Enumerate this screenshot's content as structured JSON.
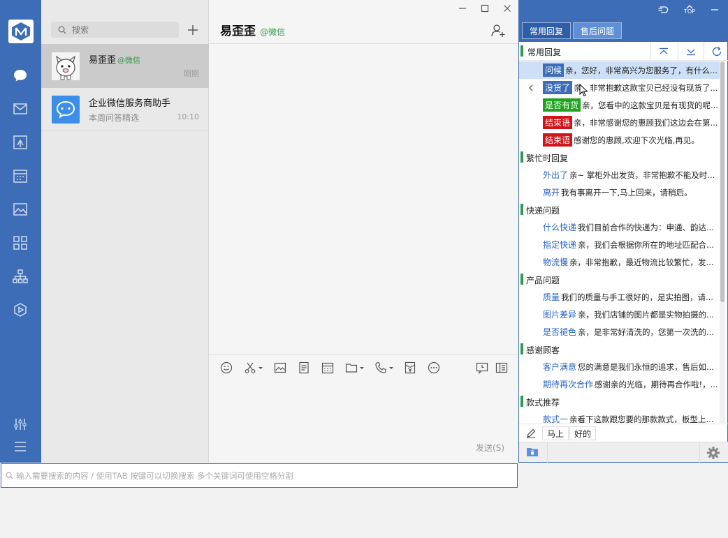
{
  "nav": {
    "items": [
      "chat-icon",
      "mail-icon",
      "share-icon",
      "calendar-icon",
      "photo-icon",
      "apps-icon",
      "org-chart-icon",
      "hexagon-play-icon"
    ],
    "bottom": [
      "settings-sliders-icon",
      "menu-icon"
    ]
  },
  "conversations": {
    "search_placeholder": "搜索",
    "items": [
      {
        "name": "易歪歪",
        "tag": "@微信",
        "subtitle": "",
        "time": "刚刚"
      },
      {
        "name": "企业微信服务商助手",
        "tag": "",
        "subtitle": "本周问答精选",
        "time": "10:10"
      }
    ]
  },
  "chat": {
    "title": "易歪歪",
    "title_suffix": "@微信",
    "send_label": "发送(S)"
  },
  "bottom_search": {
    "placeholder": "输入需要搜索的内容 / 使用TAB 按键可以切换搜索 多个关键词可使用空格分割"
  },
  "quick_reply": {
    "top_icons": [
      "undo-icon",
      "top-icon",
      "minimize-icon"
    ],
    "top_label": "TOP",
    "tabs": [
      "常用回复",
      "售后问题"
    ],
    "header": "常用回复",
    "categories": [
      {
        "name": "常用回复",
        "show_header": false,
        "rows": [
          {
            "key": "问候",
            "badge": "#3d6db7",
            "text": "亲，您好，非常高兴为您服务了，有什么...",
            "selected": true
          },
          {
            "key": "没货了",
            "badge": "#3d6db7",
            "text": "亲，非常抱歉这款宝贝已经没有现货了...",
            "selected": false
          },
          {
            "key": "是否有货",
            "badge": "#1ea31e",
            "text": "亲，您看中的这款宝贝是有现货的呢...",
            "selected": false
          },
          {
            "key": "结束语",
            "badge": "#d0141a",
            "text": "亲，非常感谢您的惠顾我们这边会在第...",
            "selected": false
          },
          {
            "key": "结束语",
            "badge": "#d0141a",
            "text": "感谢您的惠顾,欢迎下次光临,再见。",
            "selected": false
          }
        ]
      },
      {
        "name": "繁忙时回复",
        "show_header": true,
        "rows": [
          {
            "key": "外出了",
            "badge": "",
            "text": "亲~ 掌柜外出发货，非常抱歉不能及时...",
            "selected": false
          },
          {
            "key": "离开",
            "badge": "",
            "text": "我有事离开一下,马上回来，请稍后。",
            "selected": false
          }
        ]
      },
      {
        "name": "快递问题",
        "show_header": true,
        "rows": [
          {
            "key": "什么快递",
            "badge": "",
            "text": "我们目前合作的快递为：申通、韵达...",
            "selected": false
          },
          {
            "key": "指定快递",
            "badge": "",
            "text": "亲，我们会根据你所在的地址匹配合...",
            "selected": false
          },
          {
            "key": "物流慢",
            "badge": "",
            "text": "亲，非常抱歉，最近物流比较繁忙，发...",
            "selected": false
          }
        ]
      },
      {
        "name": "产品问题",
        "show_header": true,
        "rows": [
          {
            "key": "质量",
            "badge": "",
            "text": "我们的质量与手工很好的，是实拍图，请...",
            "selected": false
          },
          {
            "key": "图片差异",
            "badge": "",
            "text": "亲，我们店铺的图片都是实物拍摄的...",
            "selected": false
          },
          {
            "key": "是否褪色",
            "badge": "",
            "text": "亲，是非常好清洗的，您第一次洗的...",
            "selected": false
          }
        ]
      },
      {
        "name": "感谢顾客",
        "show_header": true,
        "rows": [
          {
            "key": "客户满意",
            "badge": "",
            "text": "您的满意是我们永恒的追求，售后如...",
            "selected": false
          },
          {
            "key": "期待再次合作",
            "badge": "",
            "text": "感谢亲的光临，期待再合作啦!，...",
            "selected": false
          }
        ]
      },
      {
        "name": "款式推荐",
        "show_header": true,
        "rows": [
          {
            "key": "款式一",
            "badge": "",
            "text": "亲看下这款跟您要的那款款式，板型上...",
            "selected": false
          }
        ]
      }
    ],
    "footer_chips": [
      "马上",
      "好的"
    ]
  }
}
